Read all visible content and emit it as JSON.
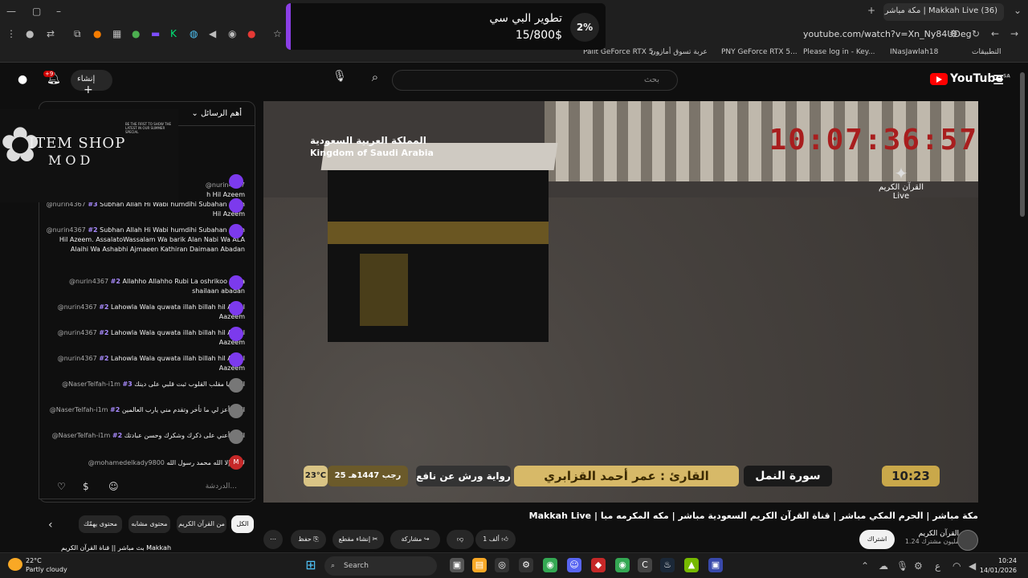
{
  "browser": {
    "tab_title": "(36) Makkah Live | مكة مباشر",
    "url": "youtube.com/watch?v=Xn_Ny84UDeg",
    "bookmarks": [
      "Palit GeForce RTX 5...",
      "عربة تسوق أمازون",
      "PNY GeForce RTX 5...",
      "Please log in - Key...",
      "INasJawlah18",
      "التطبيقات"
    ]
  },
  "notification": {
    "title": "تطوير البي سي",
    "amount": "15/800$",
    "percent": "2%"
  },
  "header": {
    "create_label": "إنشاء",
    "notif_count": "+9",
    "search_placeholder": "بحث",
    "logo_text": "YouTube",
    "logo_region": "SA"
  },
  "chat": {
    "header_label": "أهم الرسائل",
    "messages": [
      {
        "name": "@nurin4367",
        "badge": "",
        "text": "h Hil Azeem"
      },
      {
        "name": "@nurin4367",
        "badge": "#3",
        "text": "Subhan Allah Hi Wabi humdihi Subahan Allah Hil Azeem"
      },
      {
        "name": "@nurin4367",
        "badge": "#2",
        "text": "Subhan Allah Hi Wabi humdihi Subahan Allah Hil Azeem. AssalatoWassalam Wa barik Alan Nabi Wa ALA Alaihi Wa Ashabhi Ajmaeen Kathiran Daimaan Abadan"
      },
      {
        "name": "@nurin4367",
        "badge": "#2",
        "text": "Allahho Allahho Rubi La oshrikoo beka shailaan abadan"
      },
      {
        "name": "@nurin4367",
        "badge": "#2",
        "text": "Lahowla Wala quwata illah billah hil Aliyol Aazeem"
      },
      {
        "name": "@nurin4367",
        "badge": "#2",
        "text": "Lahowla Wala quwata illah billah hil Aliyol Aazeem"
      },
      {
        "name": "@nurin4367",
        "badge": "#2",
        "text": "Lahowla Wala quwata illah billah hil Aliyol Aazeem"
      },
      {
        "name": "@NaserTelfah-i1m",
        "badge": "#3",
        "text": "اللهم يا مقلب القلوب ثبت قلبي على دينك"
      },
      {
        "name": "@NaserTelfah-i1m",
        "badge": "#2",
        "text": "اللهم أعز لي ما تأخر وتقدم مني يارب العالمين"
      },
      {
        "name": "@NaserTelfah-i1m",
        "badge": "#2",
        "text": "اللهم أعني على ذكرك وشكرك وحسن عبادتك"
      },
      {
        "name": "@mohamedelkady9800",
        "badge": "",
        "text": "لا إله إلا الله محمد رسول الله"
      }
    ],
    "input_placeholder": "الدردشة..."
  },
  "item_shop": {
    "line1": "ITEM SHOP",
    "line2": "MOD",
    "promo_text": "BE THE FIRST TO SHOW THE LATEST IN OUR SUMMER SPECIAL"
  },
  "video": {
    "country_ar": "المملكة العربية السعودية",
    "country_en": "Kingdom of Saudi Arabia",
    "clock": "10:07:36:57",
    "channel_logo": "القرآن الكريم",
    "channel_logo_sub": "Live",
    "temp": "23°C",
    "hijri_date": "25 رجب 1447هـ",
    "riwaya": "رواية ورش عن نافع",
    "reader": "القارئ : عمر أحمد القزابري",
    "surah": "سورة النمل",
    "time": "10:23"
  },
  "below": {
    "title": "مكة مباشر | الحرم المكي مباشر | قناة القرآن الكريم السعودية مباشر | مكه المكرمه مبا | Makkah Live",
    "chips": [
      "الكل",
      "من القرآن الكريم",
      "محتوى مشابه",
      "محتوى يهمّك"
    ],
    "actions": [
      {
        "label": "",
        "icon": "more-icon"
      },
      {
        "label": "حفظ",
        "icon": "save-icon"
      },
      {
        "label": "إنشاء مقطع",
        "icon": "scissors-icon"
      },
      {
        "label": "مشاركة",
        "icon": "share-icon"
      },
      {
        "label": "",
        "icon": "dislike-icon"
      },
      {
        "label": "1 ألف",
        "icon": "like-icon"
      }
    ],
    "subscribe_label": "اشتراك",
    "channel_name": "القرآن الكريم",
    "channel_subs": "1.24 مليون مشترك",
    "rec_text": "بث مباشر || قناة القرآن الكريم Makkah"
  },
  "taskbar": {
    "temp": "22°C",
    "weather": "Partly cloudy",
    "search_label": "Search",
    "time": "10:24",
    "date": "14/01/2026",
    "lang": "ع"
  },
  "colors": {
    "accent": "#8b3fe6",
    "yt_red": "#ff0000",
    "clock_red": "#a81e1e"
  }
}
